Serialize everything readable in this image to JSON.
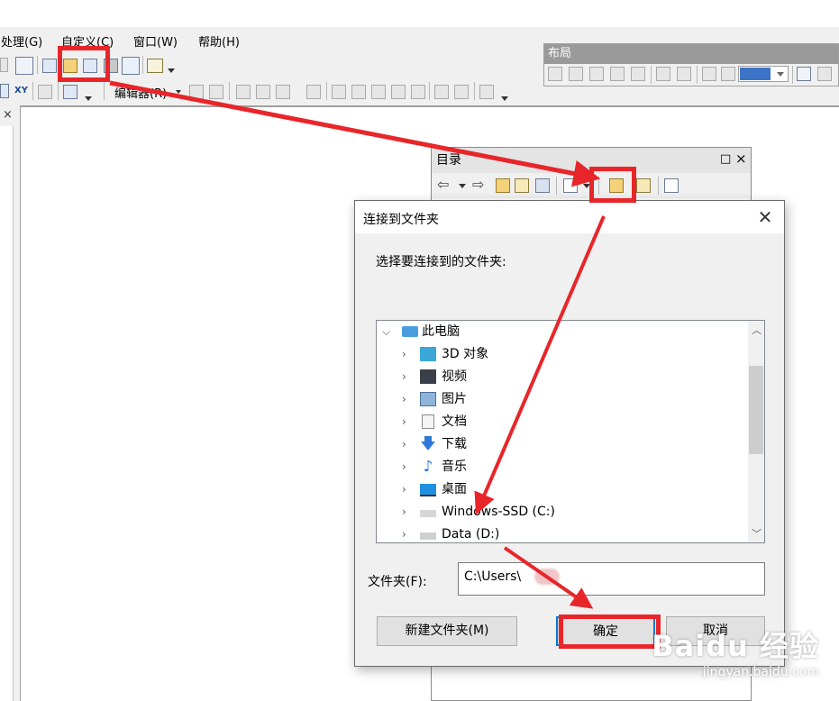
{
  "menubar": {
    "items": [
      {
        "label": "处理(G)"
      },
      {
        "label": "自定义(C)"
      },
      {
        "label": "窗口(W)"
      },
      {
        "label": "帮助(H)"
      }
    ]
  },
  "toolbar2": {
    "editor_label": "编辑器(R)",
    "xy_label": "XY"
  },
  "layout_toolbar": {
    "title": "布局",
    "zoom_value": ""
  },
  "catalog": {
    "title": "目录",
    "controls": {
      "maximize": "□",
      "close": "×"
    }
  },
  "dialog": {
    "title": "连接到文件夹",
    "close_glyph": "✕",
    "prompt": "选择要连接到的文件夹:",
    "tree": {
      "root": {
        "label": "此电脑",
        "icon": "computer-icon"
      },
      "items": [
        {
          "label": "3D 对象",
          "icon": "cube-3d-icon"
        },
        {
          "label": "视频",
          "icon": "video-film-icon"
        },
        {
          "label": "图片",
          "icon": "picture-icon"
        },
        {
          "label": "文档",
          "icon": "document-icon"
        },
        {
          "label": "下载",
          "icon": "download-arrow-icon"
        },
        {
          "label": "音乐",
          "icon": "music-note-icon"
        },
        {
          "label": "桌面",
          "icon": "desktop-icon"
        },
        {
          "label": "Windows-SSD (C:)",
          "icon": "windows-drive-icon"
        },
        {
          "label": "Data (D:)",
          "icon": "drive-icon"
        }
      ]
    },
    "folder_label": "文件夹(F):",
    "folder_value": "C:\\Users\\",
    "buttons": {
      "new_folder": "新建文件夹(M)",
      "ok": "确定",
      "cancel": "取消"
    }
  },
  "annotation": {
    "color": "#e8262a"
  },
  "watermark": {
    "main": "Baidu 经验",
    "sub": "jingyan.baidu.com"
  }
}
